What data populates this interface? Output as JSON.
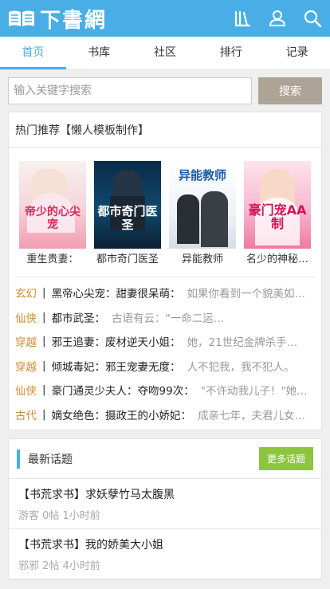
{
  "header": {
    "logo_text": "下書網",
    "icons": [
      "books-icon",
      "user-icon",
      "search-icon"
    ],
    "brand_color": "#49aee6"
  },
  "nav": {
    "tabs": [
      {
        "label": "首页",
        "active": true
      },
      {
        "label": "书库",
        "active": false
      },
      {
        "label": "社区",
        "active": false
      },
      {
        "label": "排行",
        "active": false
      },
      {
        "label": "记录",
        "active": false
      }
    ]
  },
  "search": {
    "placeholder": "输入关键字搜索",
    "button_label": "搜索"
  },
  "hot": {
    "title": "热门推荐【懒人模板制作】",
    "books": [
      {
        "title": "重生贵妻：",
        "cover_text": "帝少的心尖宠"
      },
      {
        "title": "都市奇门医圣",
        "cover_text": "都市奇门医圣"
      },
      {
        "title": "异能教师",
        "cover_text": "异能教师"
      },
      {
        "title": "名少的神秘…",
        "cover_text": "豪门宠AA制"
      }
    ],
    "list": [
      {
        "category": "玄幻",
        "title": "黑帝心尖宠：甜妻很呆萌：",
        "desc": "如果你看到一个貌美如…"
      },
      {
        "category": "仙侠",
        "title": "都市武圣：",
        "desc": "古语有云：\"一命二运…"
      },
      {
        "category": "穿越",
        "title": "邪王追妻：废材逆天小姐：",
        "desc": "她，21世纪金牌杀手…"
      },
      {
        "category": "穿越",
        "title": "倾城毒妃：邪王宠妻无度：",
        "desc": "人不犯我，我不犯人。"
      },
      {
        "category": "仙侠",
        "title": "豪门通灵少夫人：夺吻99次：",
        "desc": "\"不许动我儿子！\"她…"
      },
      {
        "category": "古代",
        "title": "嫡女绝色：摄政王的小娇妃：",
        "desc": "成亲七年，夫君儿女…"
      }
    ]
  },
  "topics": {
    "title": "最新话题",
    "more_label": "更多话题",
    "items": [
      {
        "title": "【书荒求书】求妖孽竹马太腹黑",
        "meta": "游客 0帖 1小时前"
      },
      {
        "title": "【书荒求书】我的娇美大小姐",
        "meta": "邪邪 2帖 4小时前"
      }
    ]
  }
}
